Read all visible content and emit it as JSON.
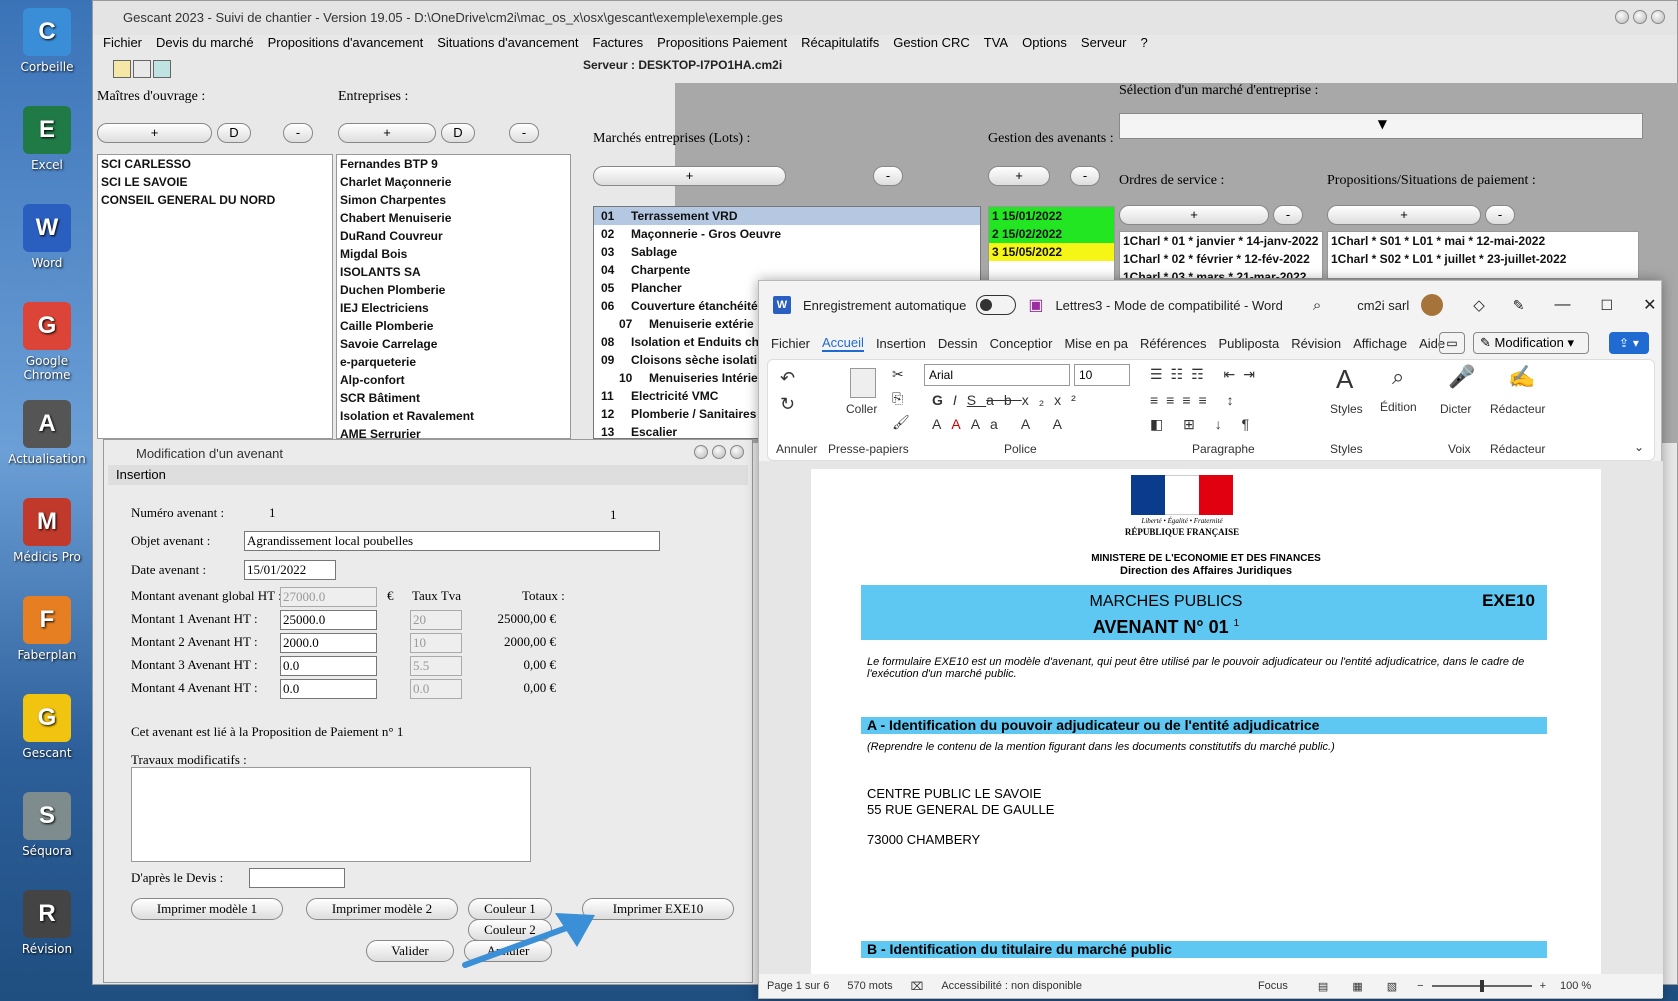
{
  "desktop": {
    "icons": [
      {
        "label": "Corbeille",
        "icon": "recycle-bin-icon",
        "color": "#3a8ed8"
      },
      {
        "label": "Excel",
        "icon": "excel-icon",
        "color": "#1f7a45"
      },
      {
        "label": "Word",
        "icon": "word-icon",
        "color": "#2b5fbf"
      },
      {
        "label": "Google Chrome",
        "icon": "chrome-icon",
        "color": "#db4437"
      },
      {
        "label": "Actualisation",
        "icon": "actualisation-icon",
        "color": "#555555"
      },
      {
        "label": "Médicis Pro",
        "icon": "medicis-icon",
        "color": "#c0392b"
      },
      {
        "label": "Faberplan",
        "icon": "faberplan-icon",
        "color": "#e67e22"
      },
      {
        "label": "Gescant",
        "icon": "gescant-icon",
        "color": "#f1c40f"
      },
      {
        "label": "Séquora",
        "icon": "sequora-icon",
        "color": "#7f8c8d"
      },
      {
        "label": "Révision",
        "icon": "revision-icon",
        "color": "#444444"
      }
    ]
  },
  "gescant": {
    "title": "Gescant 2023 - Suivi de chantier - Version 19.05 - D:\\OneDrive\\cm2i\\mac_os_x\\osx\\gescant\\exemple\\exemple.ges",
    "menu": [
      "Fichier",
      "Devis du marché",
      "Propositions d'avancement",
      "Situations d'avancement",
      "Factures",
      "Propositions Paiement",
      "Récapitulatifs",
      "Gestion CRC",
      "TVA",
      "Options",
      "Serveur",
      "?"
    ],
    "server": "Serveur : DESKTOP-I7PO1HA.cm2i",
    "maitres_label": "Maîtres d'ouvrage :",
    "entreprises_label": "Entreprises :",
    "plus": "+",
    "minus": "-",
    "d": "D",
    "maitres": [
      "SCI CARLESSO",
      "SCI LE SAVOIE",
      "CONSEIL GENERAL DU NORD"
    ],
    "entreprises": [
      "Fernandes BTP 9",
      "Charlet Maçonnerie",
      "Simon Charpentes",
      "Chabert Menuiserie",
      "DuRand Couvreur",
      "Migdal Bois",
      "ISOLANTS SA",
      "Duchen Plomberie",
      "IEJ Electriciens",
      "Caille Plomberie",
      "Savoie Carrelage",
      "e-parqueterie",
      "Alp-confort",
      "SCR Bâtiment",
      "Isolation et Ravalement",
      "AME Serrurier"
    ],
    "selection_label": "Sélection d'un marché d'entreprise :",
    "marches_label": "Marchés entreprises (Lots) :",
    "avenants_label": "Gestion des avenants :",
    "ordres_label": "Ordres de service :",
    "propositions_label": "Propositions/Situations de paiement :",
    "lots": [
      {
        "n": "01",
        "name": "Terrassement VRD"
      },
      {
        "n": "02",
        "name": "Maçonnerie - Gros Oeuvre"
      },
      {
        "n": "03",
        "name": "Sablage"
      },
      {
        "n": "04",
        "name": "Charpente"
      },
      {
        "n": "05",
        "name": "Plancher"
      },
      {
        "n": "06",
        "name": "Couverture étanchéité"
      },
      {
        "n": "07",
        "name": "Menuiserie extérie"
      },
      {
        "n": "08",
        "name": "Isolation et Enduits ch"
      },
      {
        "n": "09",
        "name": "Cloisons sèche isolati"
      },
      {
        "n": "10",
        "name": "Menuiseries Intérie"
      },
      {
        "n": "11",
        "name": "Electricité VMC"
      },
      {
        "n": "12",
        "name": "Plomberie / Sanitaires"
      },
      {
        "n": "13",
        "name": "Escalier"
      }
    ],
    "avenants": [
      {
        "text": "1 15/01/2022",
        "color": "#22e622"
      },
      {
        "text": "2 15/02/2022",
        "color": "#22e622"
      },
      {
        "text": "3 15/05/2022",
        "color": "#f5f516"
      }
    ],
    "ordres": [
      "1Charl * 01 * janvier * 14-janv-2022",
      "1Charl * 02 * février * 12-fév-2022",
      "1Charl * 03 * mars * 21-mar-2022"
    ],
    "propositions": [
      "1Charl * S01 * L01 * mai * 12-mai-2022",
      "1Charl * S02 * L01 * juillet * 23-juillet-2022"
    ]
  },
  "dialog": {
    "title": "Modification d'un avenant",
    "tab": "Insertion",
    "numero_label": "Numéro avenant :",
    "numero_value": "1",
    "numero_right": "1",
    "objet_label": "Objet avenant :",
    "objet_value": "Agrandissement local poubelles",
    "date_label": "Date avenant :",
    "date_value": "15/01/2022",
    "global_label": "Montant avenant global HT :",
    "global_value": "27000.0",
    "euro": "€",
    "taux_header": "Taux Tva",
    "totaux_header": "Totaux :",
    "rows": [
      {
        "label": "Montant 1 Avenant HT :",
        "value": "25000.0",
        "tva": "20",
        "total": "25000,00 €"
      },
      {
        "label": "Montant 2 Avenant HT :",
        "value": "2000.0",
        "tva": "10",
        "total": "2000,00 €"
      },
      {
        "label": "Montant 3 Avenant HT :",
        "value": "0.0",
        "tva": "5.5",
        "total": "0,00 €"
      },
      {
        "label": "Montant 4 Avenant HT :",
        "value": "0.0",
        "tva": "0.0",
        "total": "0,00 €"
      }
    ],
    "lie_text": "Cet avenant est lié à la Proposition de Paiement n° 1",
    "travaux_label": "Travaux modificatifs :",
    "devis_label": "D'après le Devis :",
    "btn_print1": "Imprimer modèle 1",
    "btn_print2": "Imprimer modèle 2",
    "btn_couleur1": "Couleur 1",
    "btn_couleur2": "Couleur 2",
    "btn_exe10": "Imprimer EXE10",
    "btn_valider": "Valider",
    "btn_annuler": "Annuler"
  },
  "word": {
    "autosave": "Enregistrement automatique",
    "doc_title": "Lettres3  -  Mode de compatibilité  -  Word",
    "user": "cm2i sarl",
    "tabs": [
      "Fichier",
      "Accueil",
      "Insertion",
      "Dessin",
      "Conceptior",
      "Mise en pa",
      "Références",
      "Publiposta",
      "Révision",
      "Affichage",
      "Aide"
    ],
    "active_tab": "Accueil",
    "mode_btn": "Modification",
    "groups": {
      "annuler": "Annuler",
      "coller": "Coller",
      "presse": "Presse-papiers",
      "font": "Arial",
      "size": "10",
      "police": "Police",
      "paragraphe": "Paragraphe",
      "styles": "Styles",
      "edition": "Édition",
      "dicter": "Dicter",
      "voix": "Voix",
      "redacteur": "Rédacteur"
    },
    "doc": {
      "devise": "Liberté • Égalité • Fraternité",
      "republique": "RÉPUBLIQUE FRANÇAISE",
      "ministere": "MINISTERE DE L'ECONOMIE ET DES FINANCES",
      "direction": "Direction des Affaires Juridiques",
      "marches": "MARCHES PUBLICS",
      "exe": "EXE10",
      "avenant": "AVENANT N° 01",
      "sup": "1",
      "intro": "Le formulaire EXE10 est un modèle d'avenant, qui peut être utilisé par le pouvoir adjudicateur ou l'entité adjudicatrice, dans le cadre de l'exécution d'un marché public.",
      "sectionA": "A - Identification du pouvoir adjudicateur ou de l'entité adjudicatrice",
      "reprendre": "(Reprendre le contenu de la mention figurant dans les documents constitutifs du marché public.)",
      "addr1": "CENTRE PUBLIC LE SAVOIE",
      "addr2": "55 RUE GENERAL DE GAULLE",
      "addr3": "73000 CHAMBERY",
      "sectionB": "B - Identification du titulaire du marché public",
      "accent": "#5ec8f2"
    },
    "status": {
      "page": "Page 1 sur 6",
      "words": "570 mots",
      "access": "Accessibilité : non disponible",
      "focus": "Focus",
      "zoom": "100 %"
    }
  }
}
